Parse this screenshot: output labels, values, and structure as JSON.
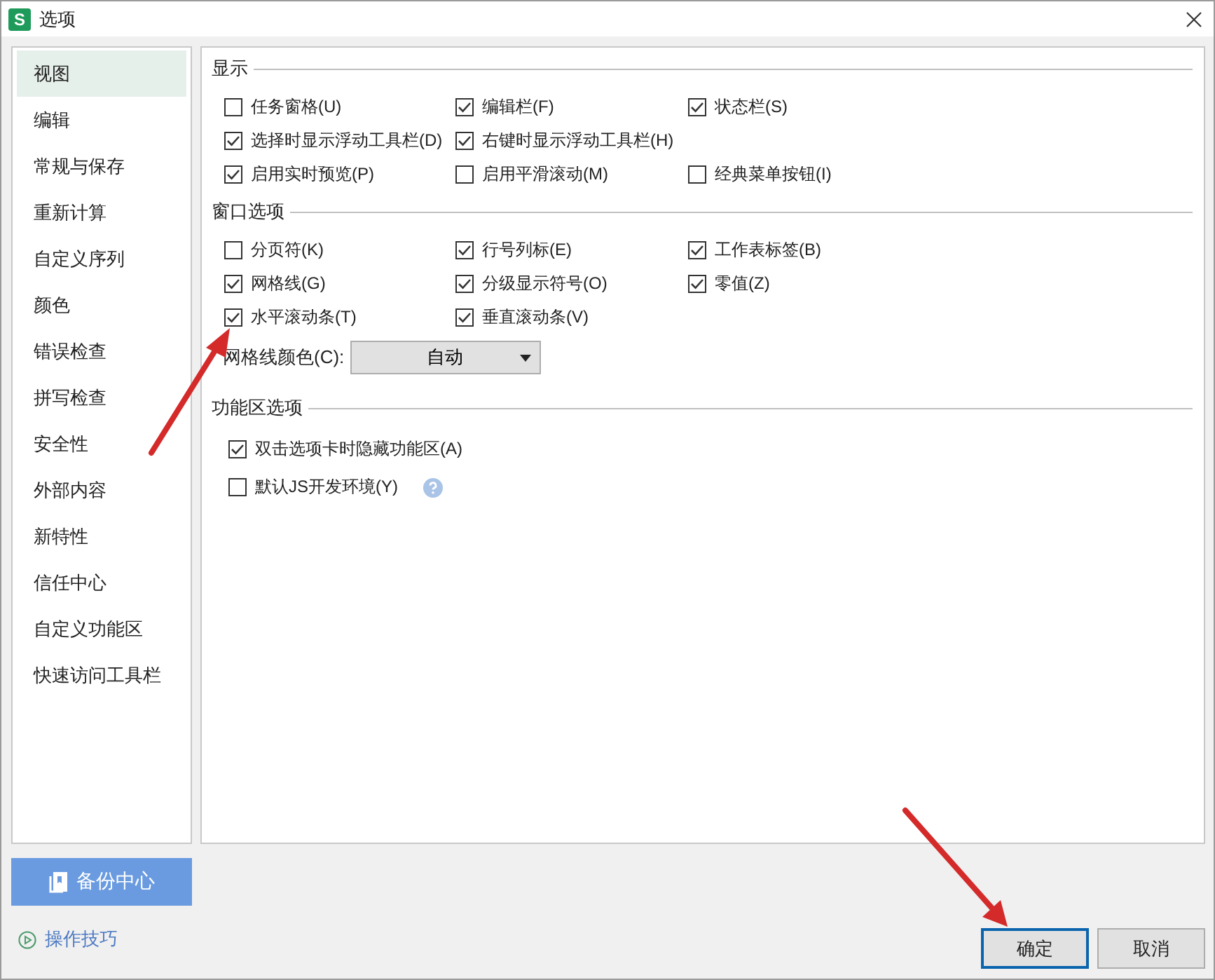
{
  "window": {
    "app_icon_letter": "S",
    "title": "选项"
  },
  "sidebar": {
    "items": [
      {
        "label": "视图",
        "selected": true
      },
      {
        "label": "编辑",
        "selected": false
      },
      {
        "label": "常规与保存",
        "selected": false
      },
      {
        "label": "重新计算",
        "selected": false
      },
      {
        "label": "自定义序列",
        "selected": false
      },
      {
        "label": "颜色",
        "selected": false
      },
      {
        "label": "错误检查",
        "selected": false
      },
      {
        "label": "拼写检查",
        "selected": false
      },
      {
        "label": "安全性",
        "selected": false
      },
      {
        "label": "外部内容",
        "selected": false
      },
      {
        "label": "新特性",
        "selected": false
      },
      {
        "label": "信任中心",
        "selected": false
      },
      {
        "label": "自定义功能区",
        "selected": false
      },
      {
        "label": "快速访问工具栏",
        "selected": false
      }
    ]
  },
  "sections": [
    {
      "kind": "grid",
      "title": "显示",
      "rows": [
        [
          {
            "label": "任务窗格(U)",
            "checked": false
          },
          {
            "label": "编辑栏(F)",
            "checked": true
          },
          {
            "label": "状态栏(S)",
            "checked": true
          }
        ],
        [
          {
            "label": "选择时显示浮动工具栏(D)",
            "checked": true
          },
          {
            "label": "右键时显示浮动工具栏(H)",
            "checked": true
          }
        ],
        [
          {
            "label": "启用实时预览(P)",
            "checked": true
          },
          {
            "label": "启用平滑滚动(M)",
            "checked": false
          },
          {
            "label": "经典菜单按钮(I)",
            "checked": false
          }
        ]
      ]
    },
    {
      "kind": "grid",
      "title": "窗口选项",
      "rows": [
        [
          {
            "label": "分页符(K)",
            "checked": false
          },
          {
            "label": "行号列标(E)",
            "checked": true
          },
          {
            "label": "工作表标签(B)",
            "checked": true
          }
        ],
        [
          {
            "label": "网格线(G)",
            "checked": true
          },
          {
            "label": "分级显示符号(O)",
            "checked": true
          },
          {
            "label": "零值(Z)",
            "checked": true
          }
        ],
        [
          {
            "label": "水平滚动条(T)",
            "checked": true
          },
          {
            "label": "垂直滚动条(V)",
            "checked": true
          }
        ]
      ],
      "gridline_color": {
        "label": "网格线颜色(C):",
        "value": "自动"
      }
    },
    {
      "kind": "list",
      "title": "功能区选项",
      "options": [
        {
          "label": "双击选项卡时隐藏功能区(A)",
          "checked": true
        },
        {
          "label": "默认JS开发环境(Y)",
          "checked": false,
          "help": true
        }
      ]
    }
  ],
  "backup_button": "备份中心",
  "tips_link": "操作技巧",
  "buttons": [
    {
      "label": "确定",
      "focused": true
    },
    {
      "label": "取消",
      "focused": false
    }
  ]
}
